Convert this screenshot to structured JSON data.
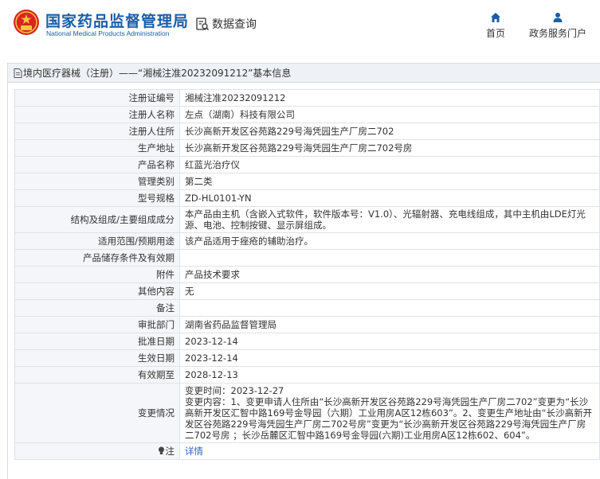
{
  "header": {
    "logo_cn": "国家药品监督管理局",
    "logo_en": "National Medical Products Administration",
    "data_query": "数据查询",
    "nav": [
      {
        "label": "首页",
        "icon": "home-icon"
      },
      {
        "label": "政务服务门户",
        "icon": "user-icon"
      }
    ]
  },
  "panel": {
    "title": "境内医疗器械（注册）——“湘械注准20232091212”基本信息"
  },
  "colors": {
    "brand_blue": "#1a5ea7",
    "emblem_red": "#d7261e",
    "link_blue": "#2a66c0",
    "label_bg": "#f4f6f9",
    "border": "#dfe2e7"
  },
  "rows": [
    {
      "label": "注册证编号",
      "value": "湘械注准20232091212"
    },
    {
      "label": "注册人名称",
      "value": "左点（湖南）科技有限公司"
    },
    {
      "label": "注册人住所",
      "value": "长沙高新开发区谷苑路229号海凭园生产厂房二702"
    },
    {
      "label": "生产地址",
      "value": "长沙高新开发区谷苑路229号海凭园生产厂房二702号房"
    },
    {
      "label": "产品名称",
      "value": "红蓝光治疗仪"
    },
    {
      "label": "管理类别",
      "value": "第二类"
    },
    {
      "label": "型号规格",
      "value": "ZD-HL0101-YN"
    },
    {
      "label": "结构及组成/主要组成成分",
      "value": "本产品由主机（含嵌入式软件，软件版本号：V1.0）、光辐射器、充电线组成，其中主机由LDE灯光源、电池、控制按键、显示屏组成。"
    },
    {
      "label": "适用范围/预期用途",
      "value": "该产品适用于痤疮的辅助治疗。"
    },
    {
      "label": "产品储存条件及有效期",
      "value": ""
    },
    {
      "label": "附件",
      "value": "产品技术要求"
    },
    {
      "label": "其他内容",
      "value": "无"
    },
    {
      "label": "备注",
      "value": ""
    },
    {
      "label": "审批部门",
      "value": "湖南省药品监督管理局"
    },
    {
      "label": "批准日期",
      "value": "2023-12-14"
    },
    {
      "label": "生效日期",
      "value": "2023-12-14"
    },
    {
      "label": "有效期至",
      "value": "2028-12-13"
    }
  ],
  "change": {
    "label": "变更情况",
    "time": "变更时间：2023-12-27",
    "content": "变更内容：1、变更申请人住所由“长沙高新开发区谷苑路229号海凭园生产厂房二702”变更为“长沙高新开发区汇智中路169号金导园（六期）工业用房A区12栋603”。2、变更生产地址由“长沙高新开发区谷苑路229号海凭园生产厂房二702号房”变更为“长沙高新开发区谷苑路229号海凭园生产厂房二702号房 ；长沙岳麓区汇智中路169号金导园(六期)工业用房A区12栋602、604”。"
  },
  "note": {
    "label": "注",
    "link": "详情"
  }
}
